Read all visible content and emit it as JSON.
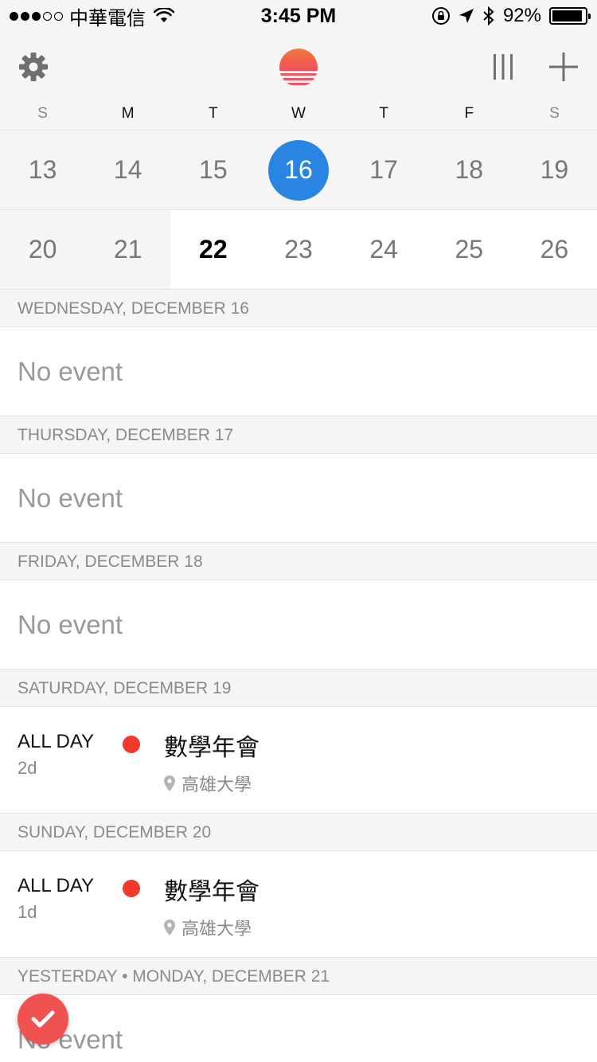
{
  "status_bar": {
    "carrier": "中華電信",
    "time": "3:45 PM",
    "battery_text": "92%",
    "battery_level": 0.92,
    "signal_filled": 3,
    "signal_total": 5
  },
  "toolbar": {
    "settings_icon": "gear-icon",
    "logo_icon": "sunrise-logo",
    "view_icon": "columns-icon",
    "add_icon": "plus-icon",
    "logo_colors": [
      "#f26b3a",
      "#f0505a"
    ]
  },
  "calendar": {
    "weekdays": [
      "S",
      "M",
      "T",
      "W",
      "T",
      "F",
      "S"
    ],
    "week1": [
      "13",
      "14",
      "15",
      "16",
      "17",
      "18",
      "19"
    ],
    "week2": [
      "20",
      "21",
      "22",
      "23",
      "24",
      "25",
      "26"
    ],
    "selected_day": "16",
    "today": "22",
    "selection_color": "#2a85e2"
  },
  "agenda": {
    "sections": [
      {
        "header": "WEDNESDAY, DECEMBER 16",
        "no_event": "No event"
      },
      {
        "header": "THURSDAY, DECEMBER 17",
        "no_event": "No event"
      },
      {
        "header": "FRIDAY, DECEMBER 18",
        "no_event": "No event"
      },
      {
        "header": "SATURDAY, DECEMBER 19",
        "event": {
          "time": "ALL DAY",
          "duration": "2d",
          "title": "數學年會",
          "location": "高雄大學",
          "color": "#f23a2c"
        }
      },
      {
        "header": "SUNDAY, DECEMBER 20",
        "event": {
          "time": "ALL DAY",
          "duration": "1d",
          "title": "數學年會",
          "location": "高雄大學",
          "color": "#f23a2c"
        }
      },
      {
        "header": "YESTERDAY • MONDAY, DECEMBER 21",
        "no_event": "No event"
      }
    ]
  },
  "fab": {
    "icon": "checkmark-icon",
    "color": "#f05252"
  }
}
